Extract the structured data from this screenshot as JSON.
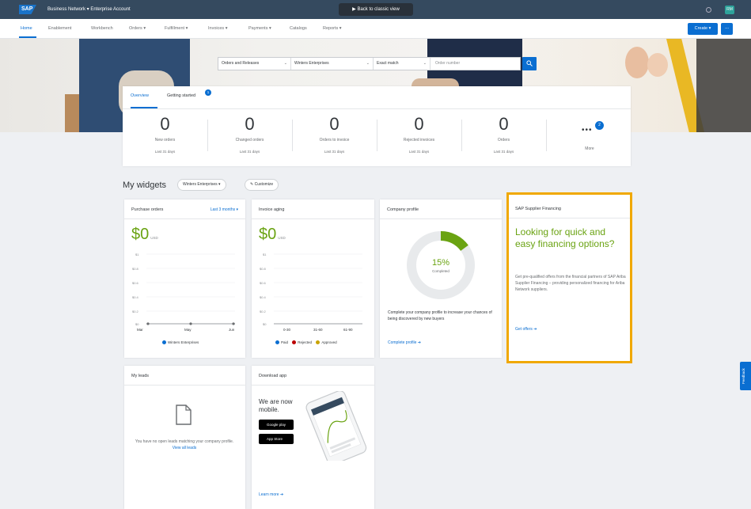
{
  "shell": {
    "logo": "SAP",
    "title": "Business Network  ▾  Enterprise Account",
    "back_to_classic": "Back to classic view",
    "avatar_initials": "RM"
  },
  "nav": {
    "items": [
      "Home",
      "Enablement",
      "Workbench",
      "Orders ▾",
      "Fulfillment ▾",
      "Invoices ▾",
      "Payments ▾",
      "Catalogs",
      "Reports ▾"
    ],
    "create_label": "Create ▾",
    "more_label": "..."
  },
  "search": {
    "document_type": "Orders and Releases",
    "customer": "Winters Enterprises",
    "match": "Exact match",
    "placeholder": "Order number"
  },
  "overview": {
    "tabs": [
      "Overview",
      "Getting started"
    ],
    "getting_started_badge": "1",
    "stats": [
      {
        "value": "0",
        "label": "New orders",
        "period": "Last 31 days"
      },
      {
        "value": "0",
        "label": "Changed orders",
        "period": "Last 31 days"
      },
      {
        "value": "0",
        "label": "Orders to invoice",
        "period": "Last 31 days"
      },
      {
        "value": "0",
        "label": "Rejected invoices",
        "period": "Last 31 days"
      },
      {
        "value": "0",
        "label": "Orders",
        "period": "Last 31 days"
      }
    ],
    "more_badge": "2",
    "more_label": "More"
  },
  "widgets": {
    "title": "My widgets",
    "customer_filter": "Winters Enterprises ▾",
    "customize": "Customize",
    "purchase_orders": {
      "title": "Purchase orders",
      "range": "Last 3 months ▾",
      "amount": "$0",
      "currency": "USD",
      "legend": "Winters Enterprises"
    },
    "invoice_aging": {
      "title": "Invoice aging",
      "amount": "$0",
      "currency": "USD",
      "legend": [
        "Paid",
        "Rejected",
        "Approved"
      ]
    },
    "company_profile": {
      "title": "Company profile",
      "percent": "15%",
      "percent_value": 15,
      "percent_label": "Completed",
      "body": "Complete your company profile to increase your chances of being discovered by new buyers",
      "link": "Complete profile  ➔"
    },
    "financing": {
      "title": "SAP Supplier Financing",
      "headline": "Looking for quick and easy financing options?",
      "body": "Get pre-qualified offers from the financial partners of SAP Ariba Supplier Financing – providing personalized financing for Ariba Network suppliers.",
      "link": "Get offers  ➔"
    },
    "my_leads": {
      "title": "My leads",
      "body": "You have no open leads matching your company profile.",
      "link": "View all leads"
    },
    "download_app": {
      "title": "Download app",
      "headline": "We are now mobile.",
      "google_play": "Google play",
      "app_store": "App Store",
      "link": "Learn more  ➔"
    }
  },
  "feedback": "Feedback",
  "colors": {
    "accent": "#0a6ed1",
    "highlight": "#f0a800",
    "positive": "#6aa312",
    "shell": "#354a5f"
  }
}
